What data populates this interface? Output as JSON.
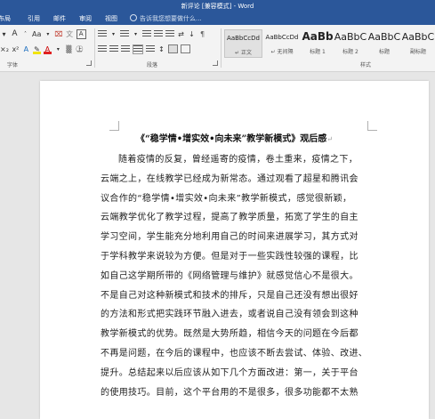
{
  "window": {
    "title": "新评论 [兼容模式] - Word"
  },
  "tabs": [
    "布局",
    "引用",
    "邮件",
    "审阅",
    "视图"
  ],
  "tell_me": {
    "placeholder": "告诉我您想要做什么..."
  },
  "ribbon": {
    "font_group_label": "字体",
    "paragraph_group_label": "段落",
    "styles_group_label": "样式",
    "font_row1": [
      "A",
      "Aa",
      "A"
    ],
    "styles": [
      {
        "sample": "AaBbCcDd",
        "name": "↵ 正文",
        "selected": true
      },
      {
        "sample": "AaBbCcDd",
        "name": "↵ 无间隔",
        "selected": false
      },
      {
        "sample": "AaBb",
        "name": "标题 1",
        "selected": false
      },
      {
        "sample": "AaBbC",
        "name": "标题 2",
        "selected": false
      },
      {
        "sample": "AaBbC",
        "name": "标题",
        "selected": false
      },
      {
        "sample": "AaBbC",
        "name": "副标题",
        "selected": false
      }
    ]
  },
  "document": {
    "title": "《“稳学情•增实效•向未来”教学新模式》观后感",
    "paragraph_mark": "↵",
    "lines": [
      "随着疫情的反复，曾经遥寄的疫情，卷土重来，疫情之下，",
      "云端之上，在线教学已经成为新常态。通过观看了超星和腾讯会",
      "议合作的“稳学情•增实效•向未来”教学新模式，感觉很新颖，",
      "云端教学优化了教学过程，提高了教学质量，拓宽了学生的自主",
      "学习空间，学生能充分地利用自己的时间来进展学习，其方式对",
      "于学科教学来说较为方便。但是对于一些实践性较强的课程，比",
      "如自己这学期所带的《网络管理与维护》就感觉信心不是很大。",
      "不是自己对这种新模式和技术的排斥，只是自己还没有想出很好",
      "的方法和形式把实践环节融入进去，或者说自己没有领会到这种",
      "教学新模式的优势。既然是大势所趋，相信今天的问题在今后都",
      "不再是问题，在今后的课程中，也应该不断去尝试、体验、改进、",
      "提升。总结起来以后应该从如下几个方面改进：第一，关于平台",
      "的使用技巧。目前，这个平台用的不是很多，很多功能都不太熟"
    ]
  }
}
